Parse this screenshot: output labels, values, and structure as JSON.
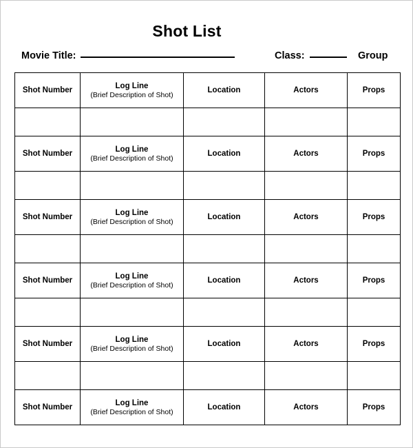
{
  "document": {
    "title": "Shot List"
  },
  "header_fields": {
    "movie_title": {
      "label": "Movie Title:",
      "value": "",
      "has_rule": true
    },
    "class": {
      "label": "Class:",
      "value": "",
      "has_rule": true
    },
    "group": {
      "label": "Group",
      "value": "",
      "has_rule": false
    }
  },
  "table": {
    "columns": [
      {
        "key": "shot_number",
        "label": "Shot Number",
        "sublabel": ""
      },
      {
        "key": "log_line",
        "label": "Log Line",
        "sublabel": "(Brief Description of Shot)"
      },
      {
        "key": "location",
        "label": "Location",
        "sublabel": ""
      },
      {
        "key": "actors",
        "label": "Actors",
        "sublabel": ""
      },
      {
        "key": "props",
        "label": "Props",
        "sublabel": ""
      }
    ],
    "rows": [
      {
        "type": "labels"
      },
      {
        "type": "blank"
      },
      {
        "type": "labels"
      },
      {
        "type": "blank"
      },
      {
        "type": "labels"
      },
      {
        "type": "blank"
      },
      {
        "type": "labels"
      },
      {
        "type": "blank"
      },
      {
        "type": "labels"
      },
      {
        "type": "blank"
      },
      {
        "type": "labels"
      }
    ],
    "blank_cell_value": ""
  },
  "style": {
    "border_color": "#000000",
    "text_color": "#000000",
    "page_border_color": "#c9c9c9",
    "background": "#ffffff"
  }
}
